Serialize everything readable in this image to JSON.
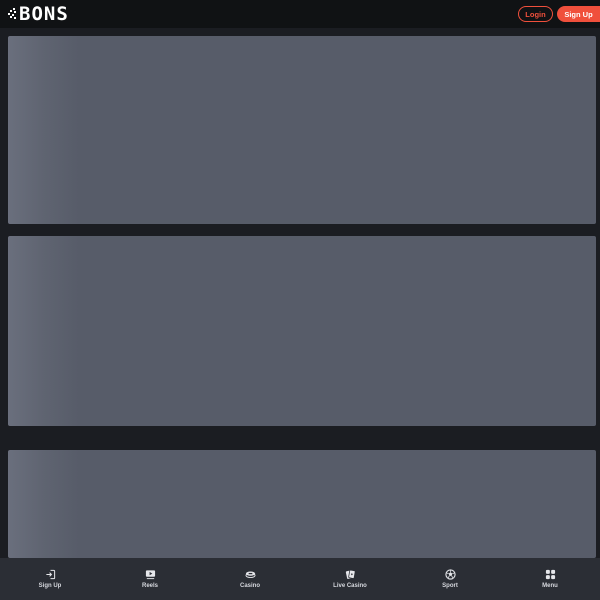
{
  "header": {
    "logo_text": "BONS",
    "login_label": "Login",
    "signup_label": "Sign Up"
  },
  "colors": {
    "accent": "#f0503c",
    "header_bg": "#101214",
    "page_bg": "#1b1d22",
    "skeleton": "#575c69",
    "nav_bg": "#2b2e35"
  },
  "bottom_nav": {
    "items": [
      {
        "label": "Sign Up",
        "icon": "sign-in-icon"
      },
      {
        "label": "Reels",
        "icon": "reels-icon"
      },
      {
        "label": "Casino",
        "icon": "casino-chips-icon"
      },
      {
        "label": "Live Casino",
        "icon": "live-cards-icon"
      },
      {
        "label": "Sport",
        "icon": "soccer-ball-icon"
      },
      {
        "label": "Menu",
        "icon": "grid-menu-icon"
      }
    ]
  }
}
